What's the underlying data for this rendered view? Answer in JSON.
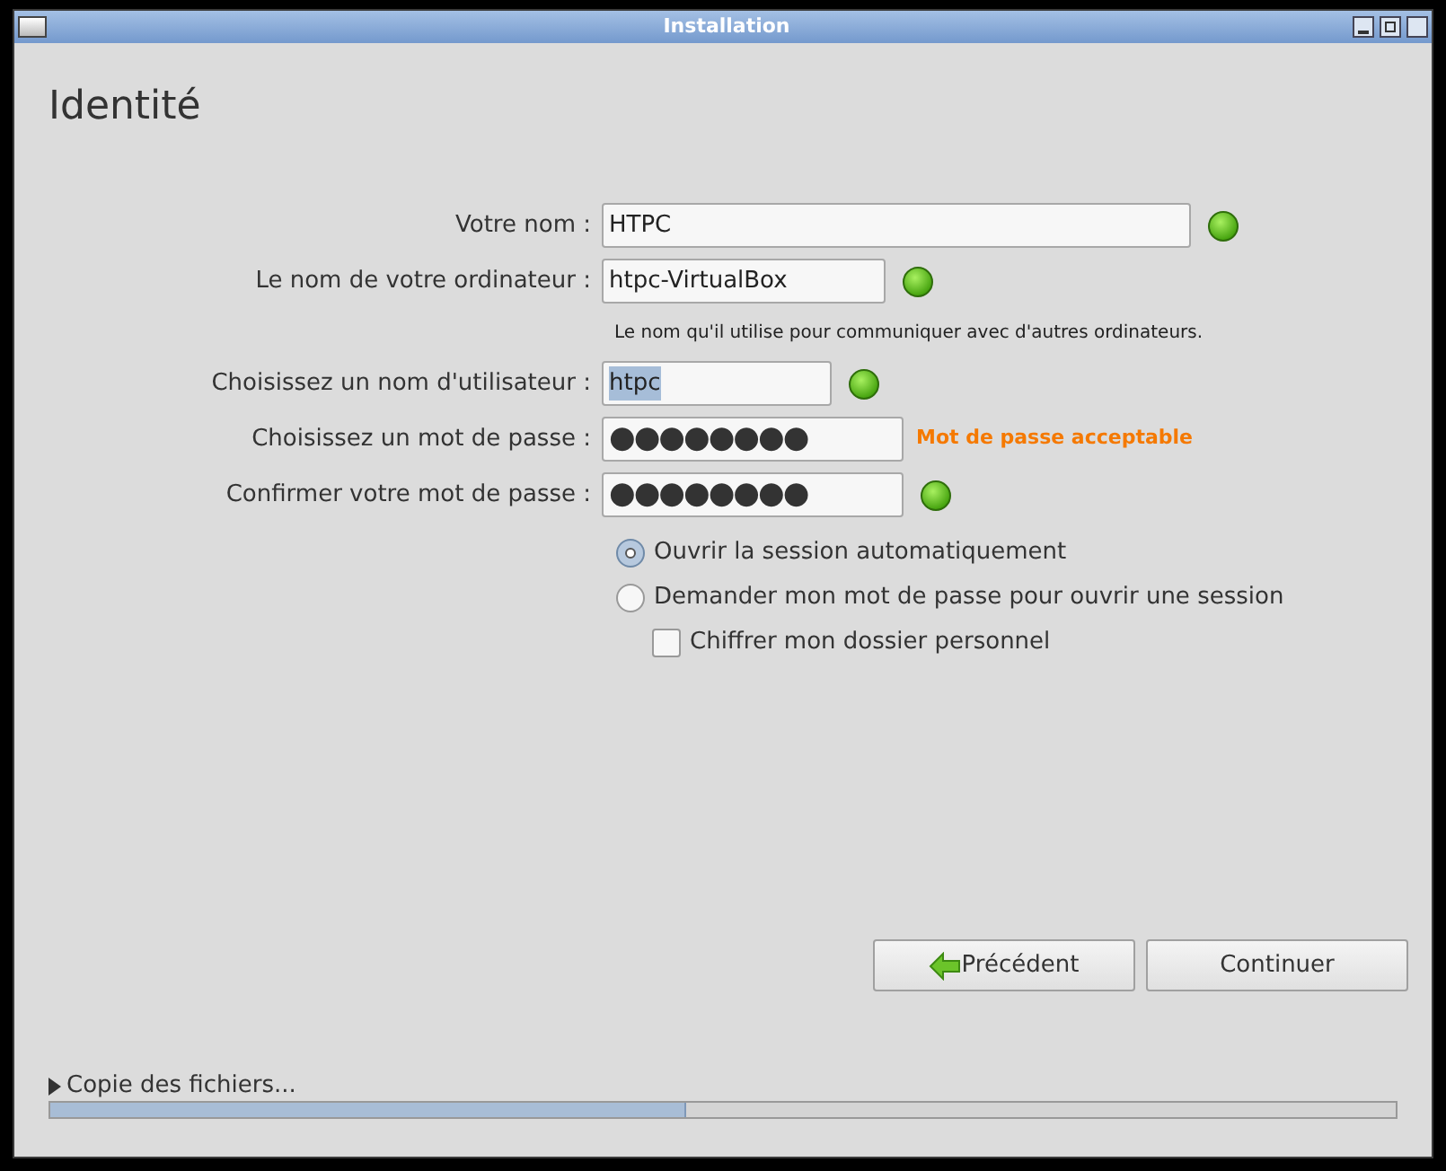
{
  "window": {
    "title": "Installation"
  },
  "heading": "Identité",
  "fields": [
    {
      "label": "Votre nom :",
      "value": "HTPC",
      "kind": "text",
      "selected_text": false,
      "valid": true
    },
    {
      "label": "Le nom de votre ordinateur :",
      "value": "htpc-VirtualBox",
      "kind": "text",
      "selected_text": false,
      "valid": true,
      "hint": "Le nom qu'il utilise pour communiquer avec d'autres ordinateurs."
    },
    {
      "label": "Choisissez un nom d'utilisateur :",
      "value": "htpc",
      "kind": "text",
      "selected_text": true,
      "valid": true
    },
    {
      "label": "Choisissez un mot de passe :",
      "value": "●●●●●●●●",
      "kind": "password",
      "selected_text": false,
      "valid": false,
      "strength": "Mot de passe acceptable"
    },
    {
      "label": "Confirmer votre mot de passe :",
      "value": "●●●●●●●●",
      "kind": "password",
      "selected_text": false,
      "valid": true
    }
  ],
  "login_options": [
    {
      "label": "Ouvrir la session automatiquement",
      "kind": "radio",
      "selected": true
    },
    {
      "label": "Demander mon mot de passe pour ouvrir une session",
      "kind": "radio",
      "selected": false
    },
    {
      "label": "Chiffrer mon dossier personnel",
      "kind": "checkbox",
      "checked": false
    }
  ],
  "buttons": [
    {
      "label": "Précédent",
      "kind": "back"
    },
    {
      "label": "Continuer",
      "kind": "plain"
    }
  ],
  "progress": {
    "label": "Copie des fichiers...",
    "expanded": false,
    "level": 0.473
  }
}
